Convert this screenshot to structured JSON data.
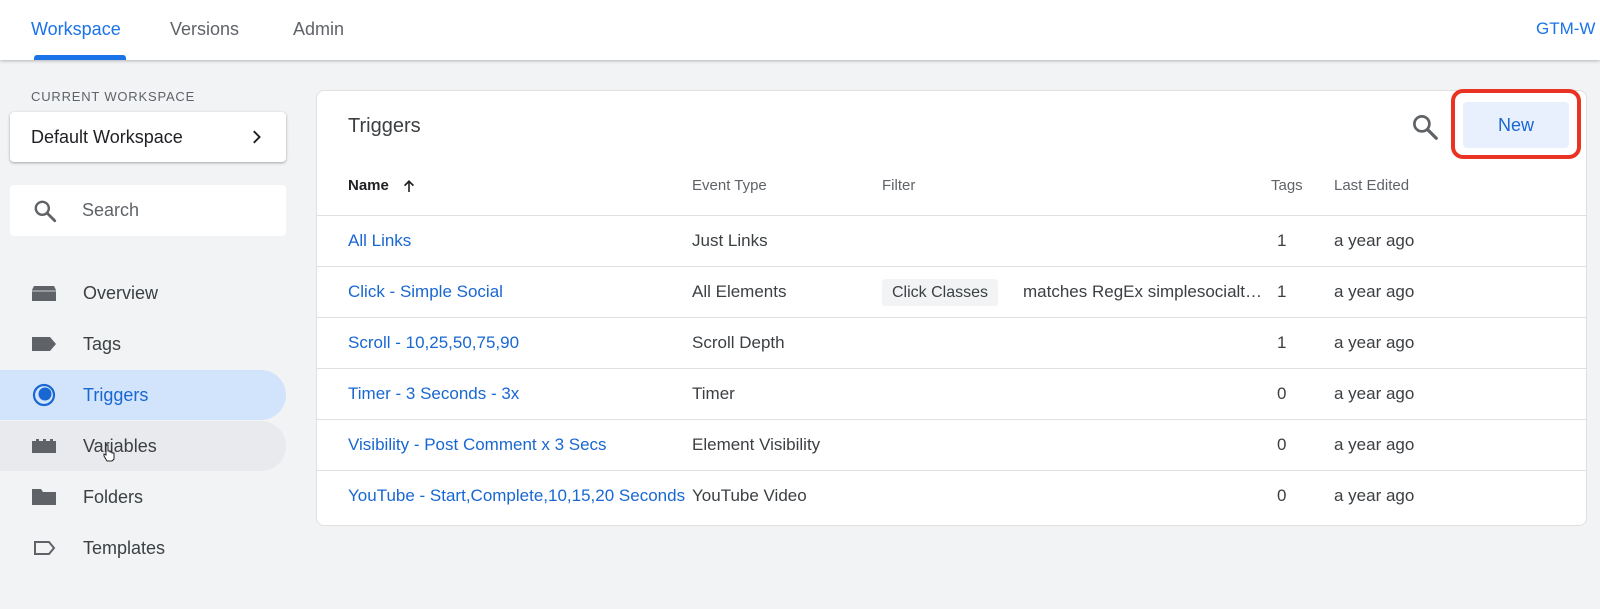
{
  "topbar": {
    "tabs": [
      {
        "label": "Workspace"
      },
      {
        "label": "Versions"
      },
      {
        "label": "Admin"
      }
    ],
    "container_id": "GTM-W"
  },
  "sidebar": {
    "workspace_caption": "CURRENT WORKSPACE",
    "workspace_name": "Default Workspace",
    "search_placeholder": "Search",
    "items": [
      {
        "label": "Overview",
        "icon": "overview-icon"
      },
      {
        "label": "Tags",
        "icon": "tag-icon"
      },
      {
        "label": "Triggers",
        "icon": "trigger-icon"
      },
      {
        "label": "Variables",
        "icon": "variables-icon"
      },
      {
        "label": "Folders",
        "icon": "folder-icon"
      },
      {
        "label": "Templates",
        "icon": "template-icon"
      }
    ]
  },
  "main": {
    "title": "Triggers",
    "new_label": "New",
    "columns": {
      "name": "Name",
      "event_type": "Event Type",
      "filter": "Filter",
      "tags": "Tags",
      "last_edited": "Last Edited"
    },
    "rows": [
      {
        "name": "All Links",
        "event_type": "Just Links",
        "filter_chip": "",
        "filter_text": "",
        "tags": "1",
        "last_edited": "a year ago"
      },
      {
        "name": "Click - Simple Social",
        "event_type": "All Elements",
        "filter_chip": "Click Classes",
        "filter_text": "matches RegEx simplesocialt…",
        "tags": "1",
        "last_edited": "a year ago"
      },
      {
        "name": "Scroll - 10,25,50,75,90",
        "event_type": "Scroll Depth",
        "filter_chip": "",
        "filter_text": "",
        "tags": "1",
        "last_edited": "a year ago"
      },
      {
        "name": "Timer - 3 Seconds - 3x",
        "event_type": "Timer",
        "filter_chip": "",
        "filter_text": "",
        "tags": "0",
        "last_edited": "a year ago"
      },
      {
        "name": "Visibility - Post Comment x 3 Secs",
        "event_type": "Element Visibility",
        "filter_chip": "",
        "filter_text": "",
        "tags": "0",
        "last_edited": "a year ago"
      },
      {
        "name": "YouTube - Start,Complete,10,15,20 Seconds",
        "event_type": "YouTube Video",
        "filter_chip": "",
        "filter_text": "",
        "tags": "0",
        "last_edited": "a year ago"
      }
    ]
  },
  "colors": {
    "accent": "#1a73e8",
    "link": "#1967d2",
    "active_nav_bg": "#d2e3fc",
    "highlight_border": "#ea3323"
  }
}
